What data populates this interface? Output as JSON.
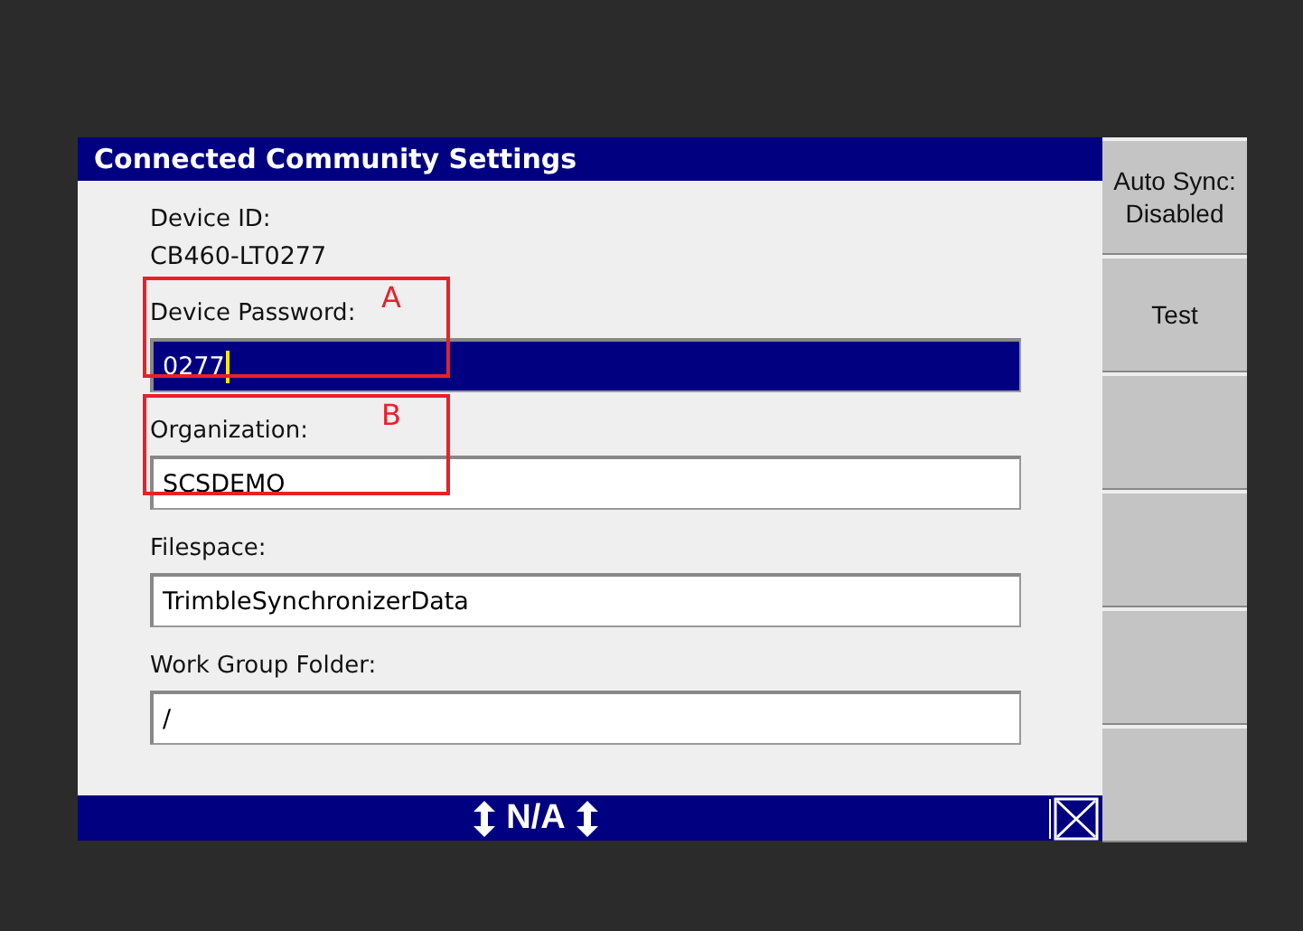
{
  "window": {
    "title": "Connected Community Settings"
  },
  "fields": [
    {
      "kind": "readonly",
      "label": "Device ID:",
      "value": "CB460-LT0277"
    },
    {
      "kind": "input",
      "label": "Device Password:",
      "value": "0277",
      "focused": true,
      "annotation": "A"
    },
    {
      "kind": "input",
      "label": "Organization:",
      "value": "SCSDEMO",
      "focused": false,
      "annotation": "B"
    },
    {
      "kind": "input",
      "label": "Filespace:",
      "value": "TrimbleSynchronizerData",
      "focused": false
    },
    {
      "kind": "input",
      "label": "Work Group Folder:",
      "value": "/",
      "focused": false
    }
  ],
  "status_bar": {
    "text": "N/A"
  },
  "softkeys": [
    {
      "label": "Auto Sync: Disabled"
    },
    {
      "label": "Test"
    }
  ]
}
